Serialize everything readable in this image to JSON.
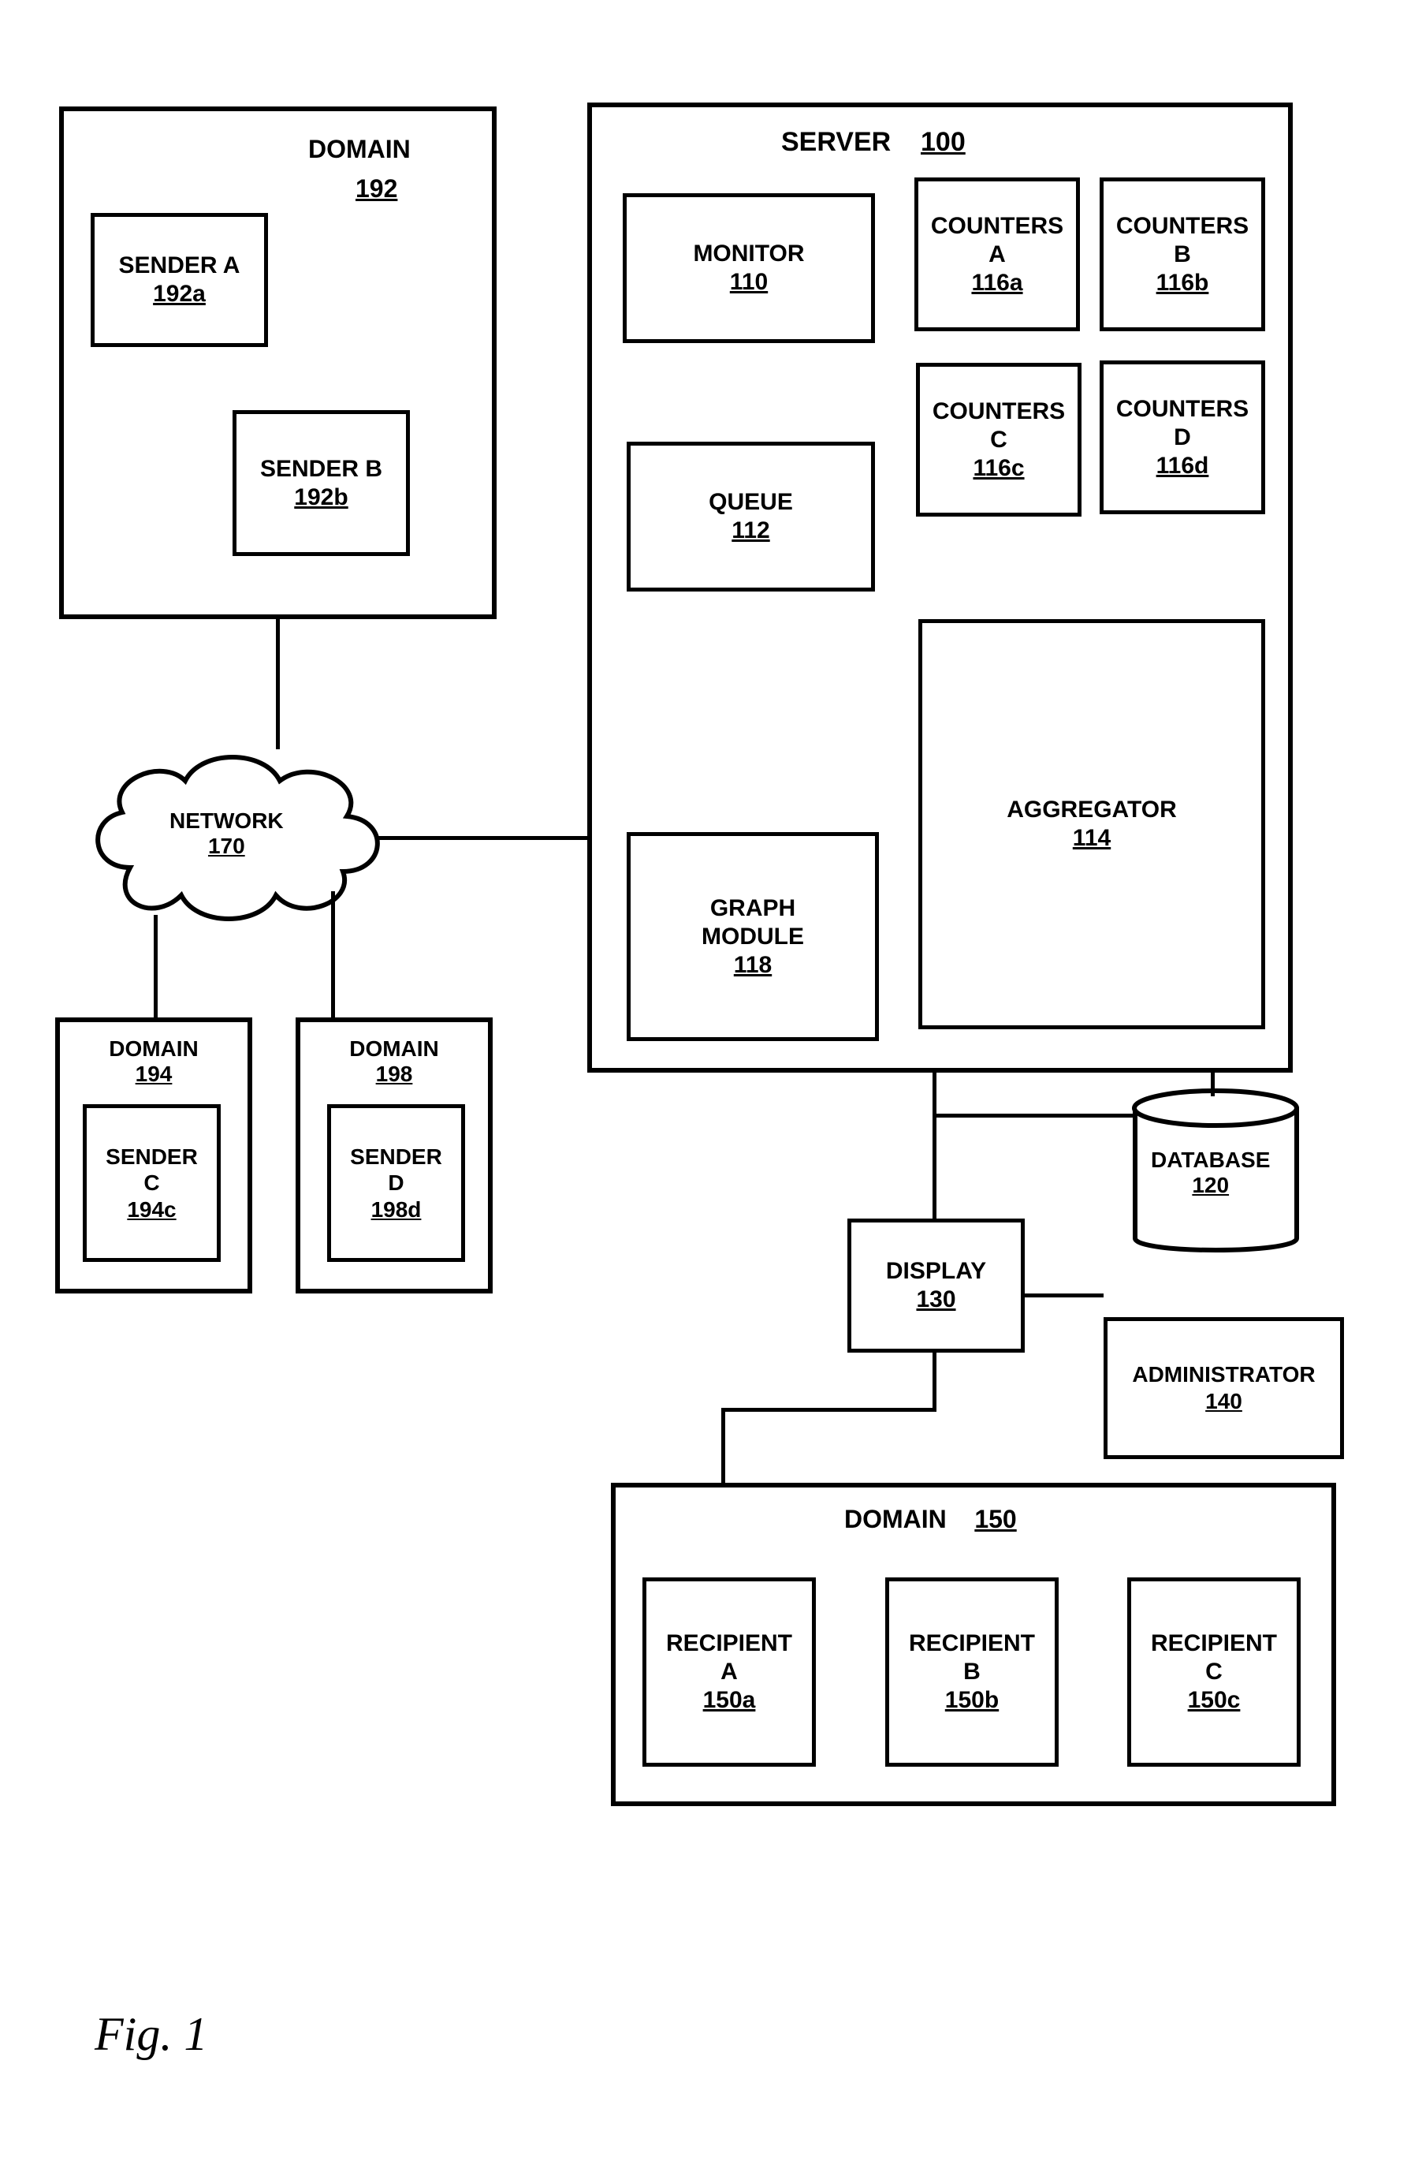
{
  "figure_caption": "Fig. 1",
  "domain192": {
    "title": "DOMAIN",
    "ref": "192",
    "senderA": {
      "title": "SENDER A",
      "ref": "192a"
    },
    "senderB": {
      "title": "SENDER B",
      "ref": "192b"
    }
  },
  "domain194": {
    "title": "DOMAIN",
    "ref": "194",
    "senderC": {
      "title": "SENDER",
      "line2": "C",
      "ref": "194c"
    }
  },
  "domain198": {
    "title": "DOMAIN",
    "ref": "198",
    "senderD": {
      "title": "SENDER",
      "line2": "D",
      "ref": "198d"
    }
  },
  "network": {
    "title": "NETWORK",
    "ref": "170"
  },
  "server": {
    "title": "SERVER",
    "ref": "100",
    "monitor": {
      "title": "MONITOR",
      "ref": "110"
    },
    "queue": {
      "title": "QUEUE",
      "ref": "112"
    },
    "graph": {
      "title": "GRAPH MODULE",
      "ref": "118"
    },
    "countersA": {
      "title": "COUNTERS",
      "line2": "A",
      "ref": "116a"
    },
    "countersB": {
      "title": "COUNTERS",
      "line2": "B",
      "ref": "116b"
    },
    "countersC": {
      "title": "COUNTERS",
      "line2": "C",
      "ref": "116c"
    },
    "countersD": {
      "title": "COUNTERS",
      "line2": "D",
      "ref": "116d"
    },
    "aggregator": {
      "title": "AGGREGATOR",
      "ref": "114"
    }
  },
  "database": {
    "title": "DATABASE",
    "ref": "120"
  },
  "display": {
    "title": "DISPLAY",
    "ref": "130"
  },
  "administrator": {
    "title": "ADMINISTRATOR",
    "ref": "140"
  },
  "domain150": {
    "title": "DOMAIN",
    "ref": "150",
    "recipientA": {
      "title": "RECIPIENT",
      "line2": "A",
      "ref": "150a"
    },
    "recipientB": {
      "title": "RECIPIENT",
      "line2": "B",
      "ref": "150b"
    },
    "recipientC": {
      "title": "RECIPIENT",
      "line2": "C",
      "ref": "150c"
    }
  }
}
